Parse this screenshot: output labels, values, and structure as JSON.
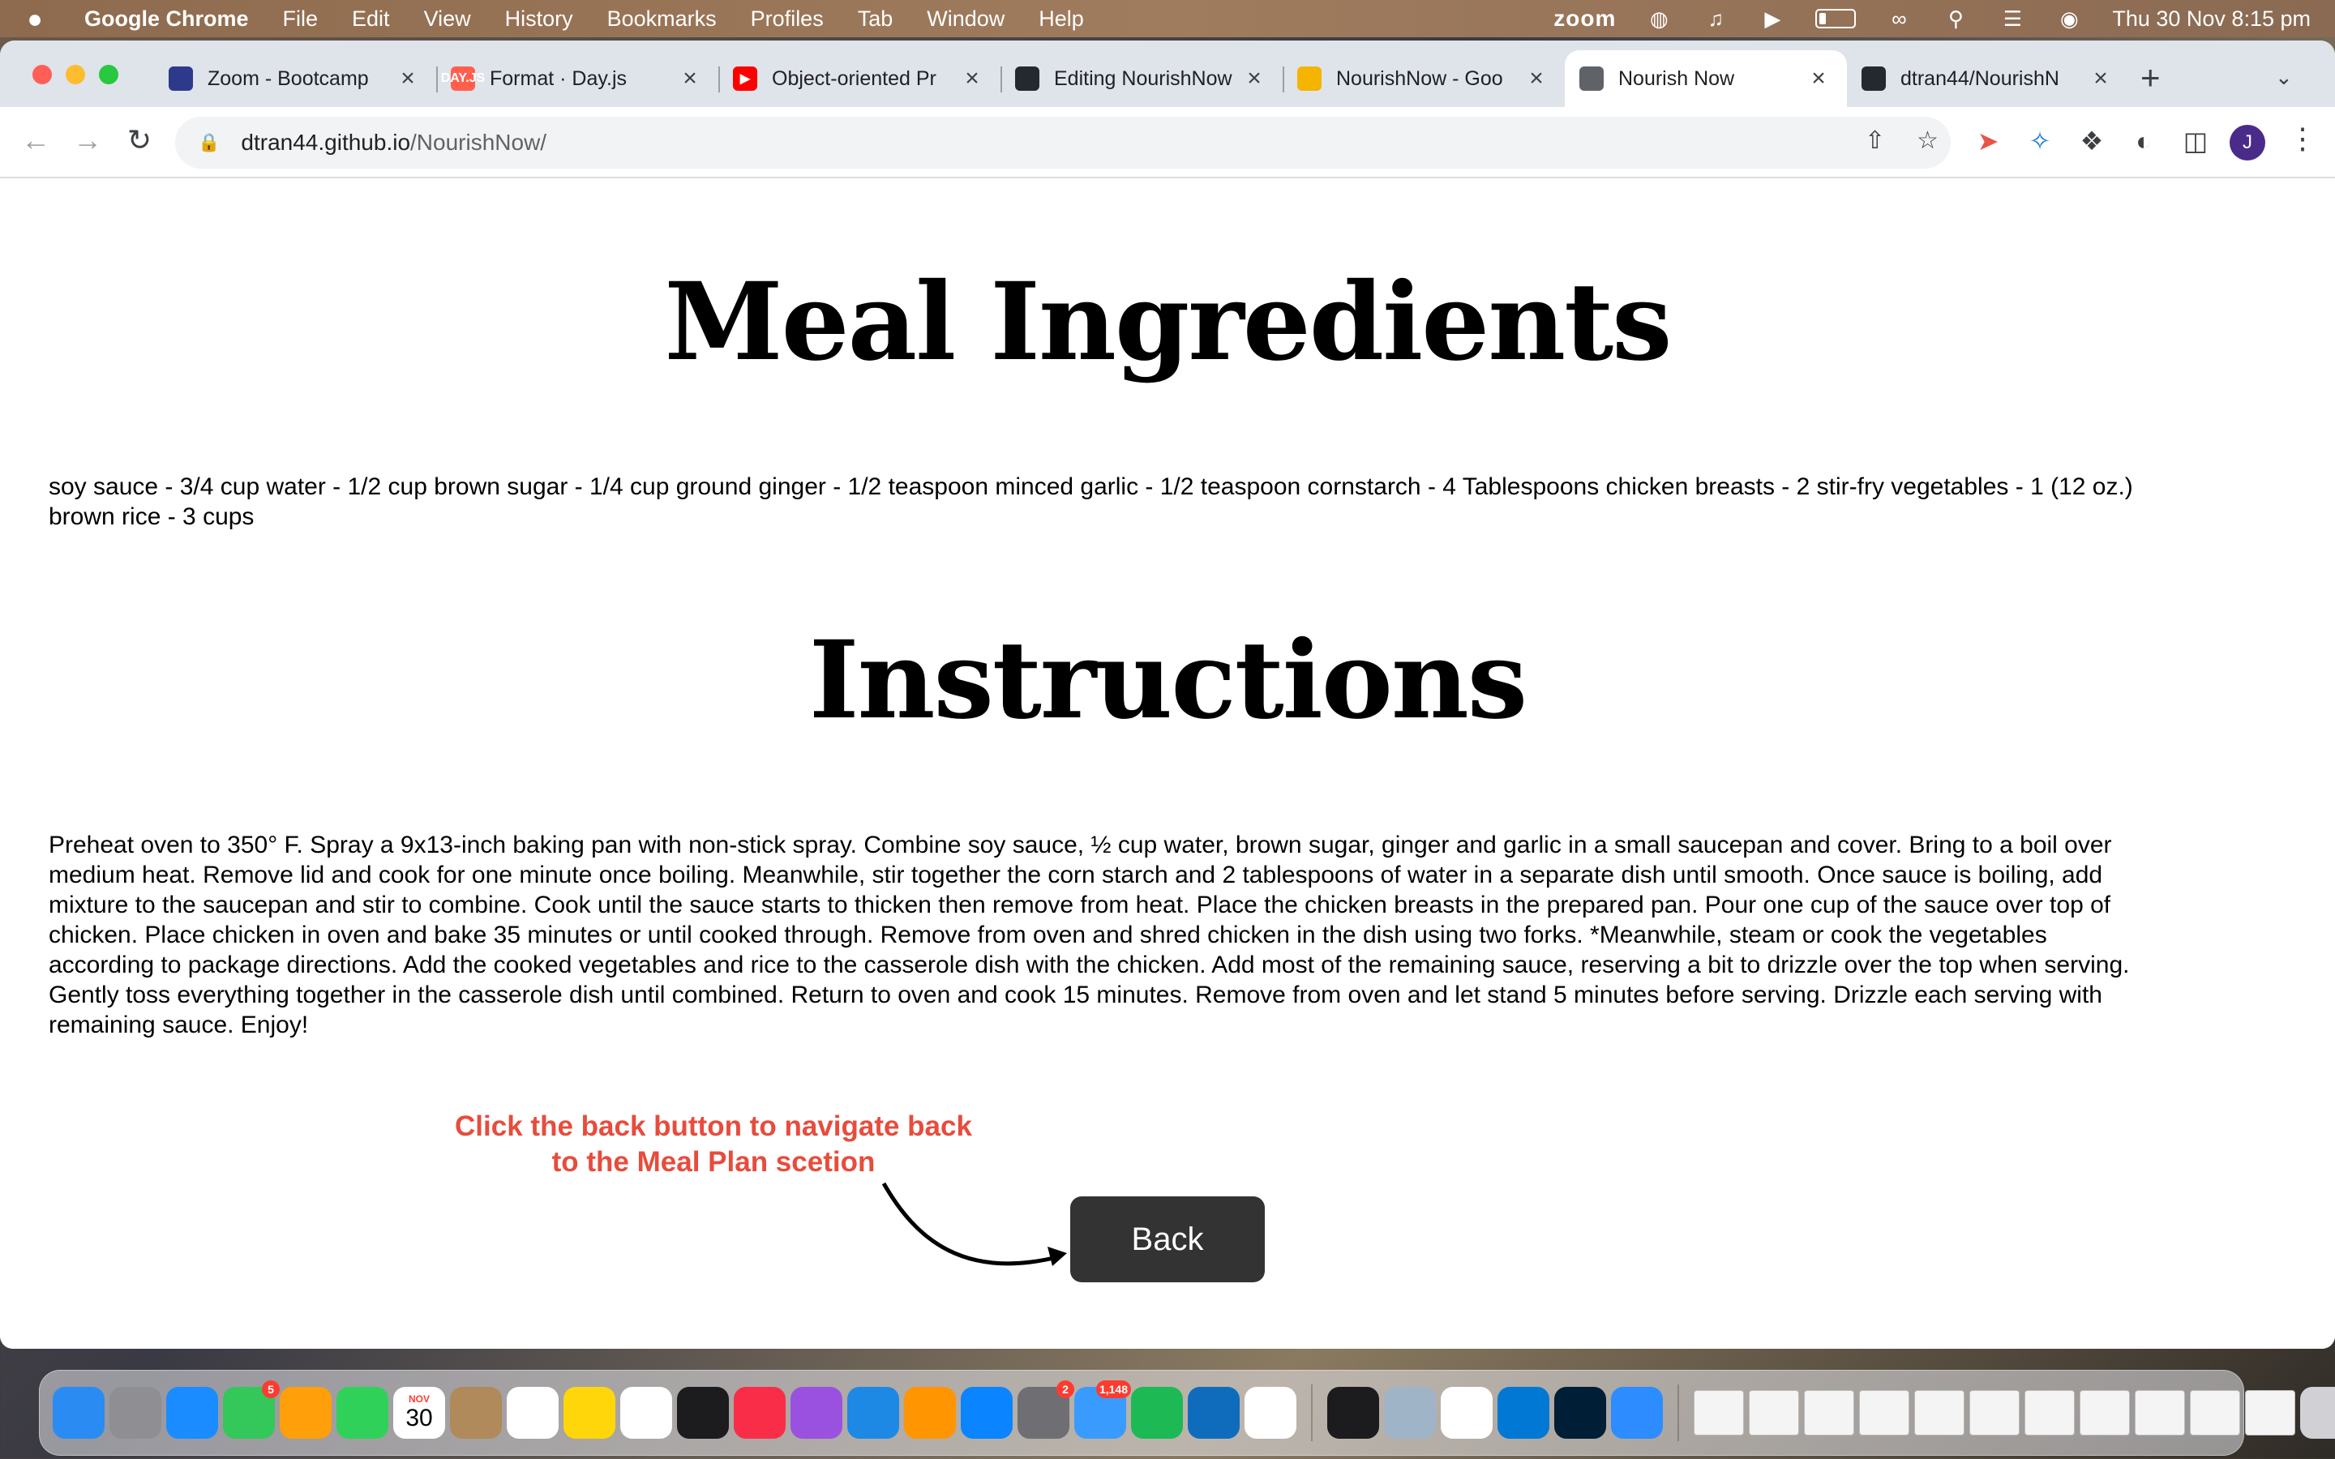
{
  "menubar": {
    "app_name": "Google Chrome",
    "items": [
      "File",
      "Edit",
      "View",
      "History",
      "Bookmarks",
      "Profiles",
      "Tab",
      "Window",
      "Help"
    ],
    "zoom_label": "zoom",
    "datetime": "Thu 30 Nov  8:15 pm"
  },
  "tabs": [
    {
      "title": "Zoom - Bootcamp",
      "favicon_color": "#2d3a8c",
      "favicon_text": ""
    },
    {
      "title": "Format · Day.js",
      "favicon_color": "#ff5f4c",
      "favicon_text": "DAY.JS"
    },
    {
      "title": "Object-oriented Pr",
      "favicon_color": "#ff0000",
      "favicon_text": "▶"
    },
    {
      "title": "Editing NourishNow",
      "favicon_color": "#24292f",
      "favicon_text": ""
    },
    {
      "title": "NourishNow - Goo",
      "favicon_color": "#f4b400",
      "favicon_text": ""
    },
    {
      "title": "Nourish Now",
      "favicon_color": "#5f6368",
      "favicon_text": "",
      "active": true
    },
    {
      "title": "dtran44/NourishN",
      "favicon_color": "#24292f",
      "favicon_text": ""
    }
  ],
  "address_bar": {
    "domain": "dtran44.github.io",
    "path": "/NourishNow/"
  },
  "profile_initial": "J",
  "page": {
    "ingredients_heading": "Meal Ingredients",
    "ingredients_text_line1": "soy sauce - 3/4 cup water - 1/2 cup brown sugar - 1/4 cup ground ginger - 1/2 teaspoon minced garlic - 1/2 teaspoon cornstarch - 4 Tablespoons chicken breasts - 2 stir-fry vegetables - 1 (12 oz.)",
    "ingredients_text_line2": "brown rice - 3 cups",
    "instructions_heading": "Instructions",
    "instructions_lines": [
      "Preheat oven to 350° F. Spray a 9x13-inch baking pan with non-stick spray. Combine soy sauce, ½ cup water, brown sugar, ginger and garlic in a small saucepan and cover. Bring to a boil over",
      "medium heat. Remove lid and cook for one minute once boiling. Meanwhile, stir together the corn starch and 2 tablespoons of water in a separate dish until smooth. Once sauce is boiling, add",
      "mixture to the saucepan and stir to combine. Cook until the sauce starts to thicken then remove from heat. Place the chicken breasts in the prepared pan. Pour one cup of the sauce over top of",
      "chicken. Place chicken in oven and bake 35 minutes or until cooked through. Remove from oven and shred chicken in the dish using two forks. *Meanwhile, steam or cook the vegetables",
      "according to package directions. Add the cooked vegetables and rice to the casserole dish with the chicken. Add most of the remaining sauce, reserving a bit to drizzle over the top when serving.",
      "Gently toss everything together in the casserole dish until combined. Return to oven and cook 15 minutes. Remove from oven and let stand 5 minutes before serving. Drizzle each serving with",
      "remaining sauce. Enjoy!"
    ],
    "annotation_line1": "Click the back button to navigate back",
    "annotation_line2": "to the Meal Plan scetion",
    "back_button": "Back"
  },
  "dock": {
    "calendar_month": "NOV",
    "calendar_day": "30",
    "messages_badge": "5",
    "settings_badge": "2",
    "mail_badge": "1,148",
    "apps": [
      "finder-icon",
      "launchpad-icon",
      "safari-icon",
      "messages-icon",
      "photos-icon",
      "facetime-icon",
      "calendar-icon",
      "contacts-icon",
      "reminders-icon",
      "notes-icon",
      "freeform-icon",
      "tv-icon",
      "music-icon",
      "podcasts-icon",
      "keynote-icon",
      "pages-icon",
      "app-store-icon",
      "system-settings-icon",
      "mail-icon",
      "spotify-icon",
      "outlook-icon",
      "chrome-icon",
      "terminal-icon",
      "preview-icon",
      "slack-icon",
      "vscode-icon",
      "photoshop-icon",
      "zoom-icon"
    ]
  },
  "colors": {
    "annotation": "#e74c3c",
    "back_button_bg": "#333333",
    "tabstrip_bg": "#dfe3ea"
  }
}
